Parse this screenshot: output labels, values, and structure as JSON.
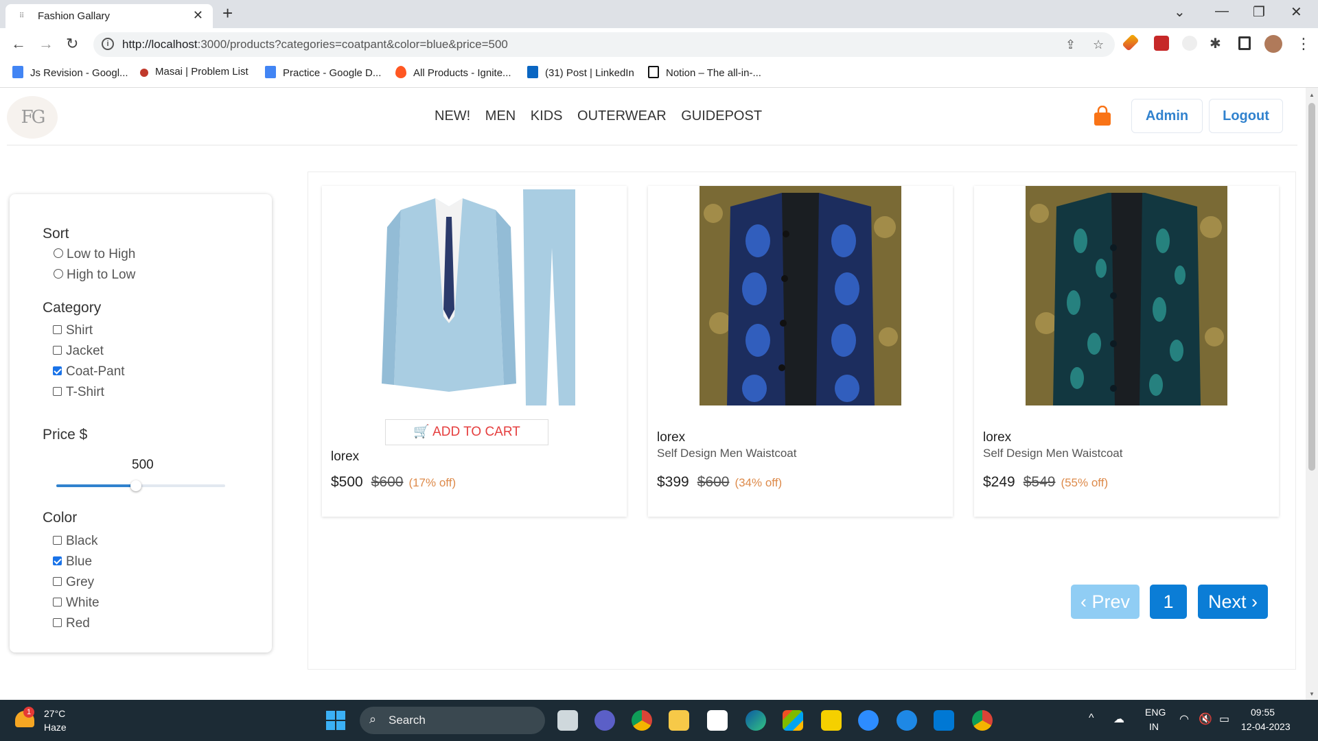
{
  "browser": {
    "tab_title": "Fashion Gallary",
    "url_host": "http://localhost",
    "url_rest": ":3000/products?categories=coatpant&color=blue&price=500",
    "bookmarks": [
      {
        "label": "Js Revision - Googl...",
        "color": "#4285f4"
      },
      {
        "label": "Masai | Problem List",
        "color": "#c0392b"
      },
      {
        "label": "Practice - Google D...",
        "color": "#4285f4"
      },
      {
        "label": "All Products - Ignite...",
        "color": "#ff5722"
      },
      {
        "label": "(31) Post | LinkedIn",
        "color": "#0a66c2"
      },
      {
        "label": "Notion – The all-in-...",
        "color": "#111111"
      }
    ]
  },
  "header": {
    "logo": "FG",
    "menu": [
      "NEW!",
      "MEN",
      "KIDS",
      "OUTERWEAR",
      "GUIDEPOST"
    ],
    "admin_label": "Admin",
    "logout_label": "Logout",
    "accent": "#3182ce",
    "cart_color": "#f97316"
  },
  "filters": {
    "sort_heading": "Sort",
    "sort_options": [
      {
        "label": "Low to High",
        "checked": false
      },
      {
        "label": "High to Low",
        "checked": false
      }
    ],
    "category_heading": "Category",
    "categories": [
      {
        "label": "Shirt",
        "checked": false
      },
      {
        "label": "Jacket",
        "checked": false
      },
      {
        "label": "Coat-Pant",
        "checked": true
      },
      {
        "label": "T-Shirt",
        "checked": false
      }
    ],
    "price_heading": "Price $",
    "price_value": "500",
    "price_fraction": 0.47,
    "color_heading": "Color",
    "colors": [
      {
        "label": "Black",
        "checked": false
      },
      {
        "label": "Blue",
        "checked": true
      },
      {
        "label": "Grey",
        "checked": false
      },
      {
        "label": "White",
        "checked": false
      },
      {
        "label": "Red",
        "checked": false
      }
    ]
  },
  "products": [
    {
      "brand": "lorex",
      "name": "",
      "price": "$500",
      "old_price": "$600",
      "off": "(17% off)",
      "add_to_cart": "ADD TO CART",
      "image": "light-blue-suit"
    },
    {
      "brand": "lorex",
      "name": "Self Design Men Waistcoat",
      "price": "$399",
      "old_price": "$600",
      "off": "(34% off)",
      "image": "blue-waistcoat"
    },
    {
      "brand": "lorex",
      "name": "Self Design Men Waistcoat",
      "price": "$249",
      "old_price": "$549",
      "off": "(55% off)",
      "image": "teal-waistcoat"
    }
  ],
  "pagination": {
    "prev_label": "‹ Prev",
    "page_label": "1",
    "next_label": "Next ›"
  },
  "taskbar": {
    "weather_temp": "27°C",
    "weather_desc": "Haze",
    "weather_badge": "1",
    "search_label": "Search",
    "lang": "ENG",
    "region": "IN",
    "time": "09:55",
    "date": "12-04-2023"
  }
}
